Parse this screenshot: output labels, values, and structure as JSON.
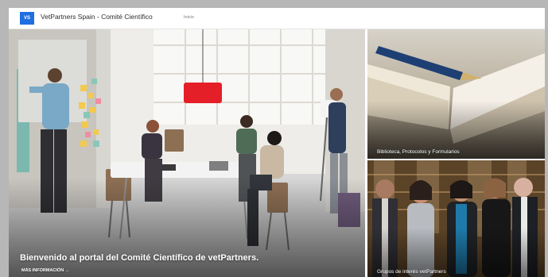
{
  "header": {
    "logo_text": "VS",
    "site_title": "VetPartners Spain - Comité Científico",
    "nav_home": "Inicio"
  },
  "hero": {
    "title": "Bienvenido al portal del Comité Científico de vetPartners.",
    "link_text": "MÁS INFORMACIÓN →"
  },
  "tiles": [
    {
      "caption": "Biblioteca, Protocolos y Formularios"
    },
    {
      "caption": "Grupos de interés vetPartners"
    }
  ],
  "colors": {
    "brand_blue": "#1f6fe0",
    "lamp_red": "#e31b23",
    "backdrop": "#b7b7b7"
  }
}
